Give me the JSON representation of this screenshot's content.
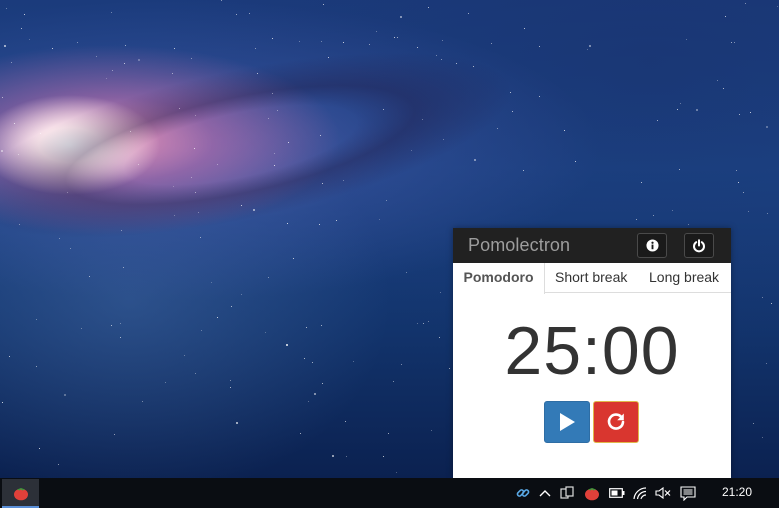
{
  "app": {
    "title": "Pomolectron",
    "tabs": [
      {
        "label": "Pomodoro",
        "active": true
      },
      {
        "label": "Short break",
        "active": false
      },
      {
        "label": "Long break",
        "active": false
      }
    ],
    "timer": "25:00",
    "icons": {
      "info": "info-icon",
      "power": "power-icon",
      "play": "play-icon",
      "reset": "reset-icon"
    },
    "colors": {
      "header": "#212121",
      "play_button": "#337ab7",
      "reset_button": "#d9362f"
    }
  },
  "taskbar": {
    "clock": "21:20",
    "pinned_app_icon": "tomato-icon",
    "tray_icons": [
      "link-icon",
      "chevron-up-icon",
      "network-app-icon",
      "tomato-icon",
      "battery-icon",
      "wifi-icon",
      "volume-muted-icon",
      "notifications-icon"
    ]
  }
}
